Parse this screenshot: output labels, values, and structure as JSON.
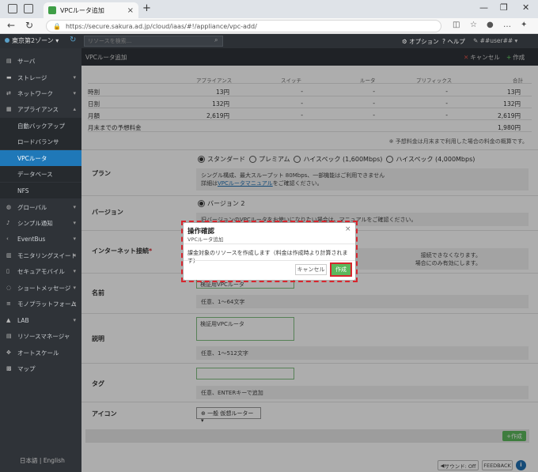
{
  "browser": {
    "tab_title": "VPCルータ追加",
    "url": "https://secure.sakura.ad.jp/cloud/iaas/#!/appliance/vpc-add/"
  },
  "header": {
    "zone": "東京第2ゾーン",
    "search_placeholder": "リソースを検索...",
    "options": "オプション",
    "help": "ヘルプ",
    "user": "##user##"
  },
  "sidebar": {
    "items": [
      {
        "label": "サーバ",
        "icon": "server-icon",
        "chevron": false
      },
      {
        "label": "ストレージ",
        "icon": "storage-icon",
        "chevron": true
      },
      {
        "label": "ネットワーク",
        "icon": "network-icon",
        "chevron": true
      },
      {
        "label": "アプライアンス",
        "icon": "appliance-icon",
        "chevron": true
      }
    ],
    "subitems": [
      "自動バックアップ",
      "ロードバランサ",
      "VPCルータ",
      "データベース",
      "NFS"
    ],
    "items2": [
      {
        "label": "グローバル",
        "icon": "globe-icon"
      },
      {
        "label": "シンプル通知",
        "icon": "bell-icon"
      },
      {
        "label": "EventBus",
        "icon": "share-icon"
      },
      {
        "label": "モニタリングスイート",
        "icon": "monitor-icon"
      },
      {
        "label": "セキュアモバイル",
        "icon": "mobile-icon"
      },
      {
        "label": "ショートメッセージ",
        "icon": "message-icon"
      },
      {
        "label": "モノプラットフォーム",
        "icon": "platform-icon"
      },
      {
        "label": "LAB",
        "icon": "lab-icon"
      }
    ],
    "items3": [
      {
        "label": "リソースマネージャ",
        "icon": "resource-icon"
      },
      {
        "label": "オートスケール",
        "icon": "autoscale-icon"
      },
      {
        "label": "マップ",
        "icon": "map-icon"
      }
    ],
    "lang_ja": "日本語",
    "lang_sep": "|",
    "lang_en": "English"
  },
  "page": {
    "title": "VPCルータ追加",
    "cancel": "キャンセル",
    "create": "作成"
  },
  "pricing": {
    "headers": [
      "アプライアンス",
      "スイッチ",
      "ルータ",
      "プリフィックス",
      "合計"
    ],
    "rows": [
      {
        "label": "時割",
        "appliance": "13円",
        "switch": "-",
        "router": "-",
        "prefix": "-",
        "total": "13円"
      },
      {
        "label": "日割",
        "appliance": "132円",
        "switch": "-",
        "router": "-",
        "prefix": "-",
        "total": "132円"
      },
      {
        "label": "月額",
        "appliance": "2,619円",
        "switch": "-",
        "router": "-",
        "prefix": "-",
        "total": "2,619円"
      }
    ],
    "estimate_label": "月末までの予想料金",
    "estimate_value": "1,980円",
    "note": "※ 予想料金は月末まで利用した場合の料金の概算です。"
  },
  "form": {
    "plan_label": "プラン",
    "plan_options": [
      "スタンダード",
      "プレミアム",
      "ハイスペック (1,600Mbps)",
      "ハイスペック (4,000Mbps)"
    ],
    "plan_help_1": "シングル構成、最大スループット 80Mbps、一部機能はご利用できません",
    "plan_help_2a": "詳細は",
    "plan_help_link": "VPCルータマニュアル",
    "plan_help_2b": "をご確認ください。",
    "version_label": "バージョン",
    "version_value": "バージョン 2",
    "version_help": "旧バージョンのVPCルータをお使いになりたい場合は、マニュアルをご確認ください。",
    "internet_label": "インターネット接続",
    "internet_required": "*",
    "internet_help_1": "接続できなくなります。",
    "internet_help_2": "場合にのみ有効にします。",
    "name_label": "名前",
    "name_value": "検証用VPCルータ",
    "name_help": "任意、1～64文字",
    "desc_label": "説明",
    "desc_value": "検証用VPCルータ",
    "desc_help": "任意、1～512文字",
    "tag_label": "タグ",
    "tag_help": "任意、ENTERキーで追加",
    "icon_label": "アイコン",
    "icon_value": "一般 仮想ルーター",
    "footer_create": "作成"
  },
  "bottom": {
    "sound": "サウンド: Off",
    "feedback": "FEEDBACK",
    "info": "i"
  },
  "modal": {
    "title": "操作確認",
    "subtitle": "VPCルータ追加",
    "body": "課金対象のリソースを作成します（料金は作成時より計算されます）",
    "cancel": "キャンセル",
    "create": "作成",
    "close": "×"
  }
}
